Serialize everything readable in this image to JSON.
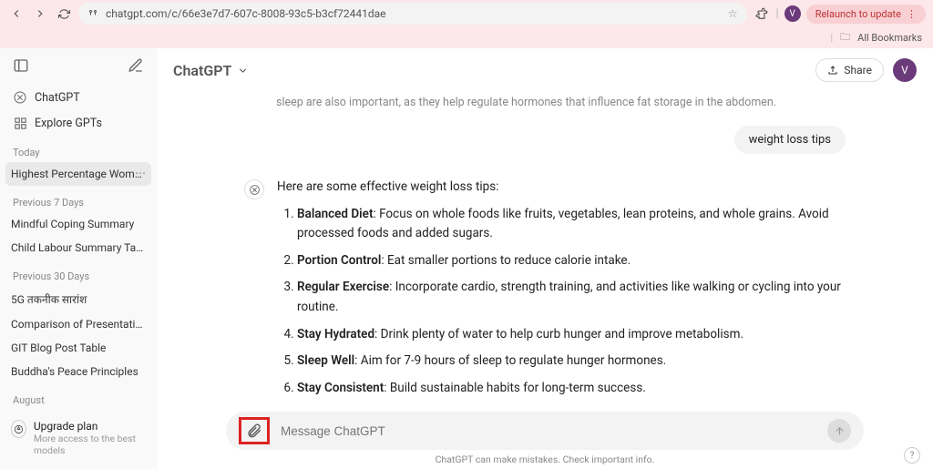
{
  "browser": {
    "url": "chatgpt.com/c/66e3e7d7-607c-8008-93c5-b3cf72441dae",
    "relaunch_label": "Relaunch to update",
    "bookmarks_label": "All Bookmarks",
    "avatar_letter": "V"
  },
  "sidebar": {
    "nav": {
      "chatgpt": "ChatGPT",
      "explore": "Explore GPTs"
    },
    "sections": [
      {
        "label": "Today",
        "items": [
          "Highest Percentage Women"
        ]
      },
      {
        "label": "Previous 7 Days",
        "items": [
          "Mindful Coping Summary",
          "Child Labour Summary Table"
        ]
      },
      {
        "label": "Previous 30 Days",
        "items": [
          "5G तकनीक सारांश",
          "Comparison of Presentation Tool",
          "GIT Blog Post Table",
          "Buddha's Peace Principles"
        ]
      },
      {
        "label": "August",
        "items": []
      }
    ],
    "upgrade": {
      "title": "Upgrade plan",
      "subtitle": "More access to the best models"
    }
  },
  "header": {
    "model": "ChatGPT",
    "share_label": "Share",
    "avatar_letter": "V"
  },
  "conversation": {
    "cutoff_text": "sleep are also important, as they help regulate hormones that influence fat storage in the abdomen.",
    "user_message": "weight loss tips",
    "assistant_intro": "Here are some effective weight loss tips:",
    "tips": [
      {
        "title": "Balanced Diet",
        "body": ": Focus on whole foods like fruits, vegetables, lean proteins, and whole grains. Avoid processed foods and added sugars."
      },
      {
        "title": "Portion Control",
        "body": ": Eat smaller portions to reduce calorie intake."
      },
      {
        "title": "Regular Exercise",
        "body": ": Incorporate cardio, strength training, and activities like walking or cycling into your routine."
      },
      {
        "title": "Stay Hydrated",
        "body": ": Drink plenty of water to help curb hunger and improve metabolism."
      },
      {
        "title": "Sleep Well",
        "body": ": Aim for 7-9 hours of sleep to regulate hunger hormones."
      },
      {
        "title": "Stay Consistent",
        "body": ": Build sustainable habits for long-term success."
      }
    ]
  },
  "composer": {
    "placeholder": "Message ChatGPT",
    "disclaimer": "ChatGPT can make mistakes. Check important info."
  }
}
